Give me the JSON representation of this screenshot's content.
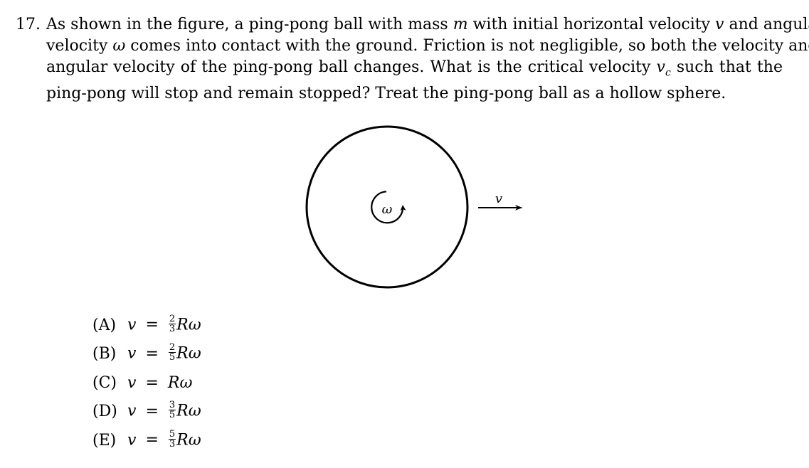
{
  "question": {
    "number": "17.",
    "lines": [
      "As shown in the figure, a ping-pong ball with mass m with initial horizontal velocity v and angular",
      "velocity ω comes into contact with the ground. Friction is not negligible, so both the velocity and",
      "angular velocity of the ping-pong ball changes. What is the critical velocity v_c such that the",
      "ping-pong will stop and remain stopped? Treat the ping-pong ball as a hollow sphere."
    ],
    "segments": {
      "l1a": "As shown in the figure, a ping-pong ball with mass ",
      "m": "m",
      "l1b": " with initial horizontal velocity ",
      "v1": "v",
      "l1c": " and angular",
      "l2a": "velocity ",
      "w": "ω",
      "l2b": " comes into contact with the ground. Friction is not negligible, so both the velocity and",
      "l3a": "angular velocity of the ping-pong ball changes.  What is the critical velocity ",
      "vc": "v",
      "vc_sub": "c",
      "l3b": " such that the",
      "l4": "ping-pong will stop and remain stopped? Treat the ping-pong ball as a hollow sphere."
    }
  },
  "figure": {
    "omega_label": "ω",
    "velocity_label": "v"
  },
  "choices": [
    {
      "label": "(A)",
      "lhs": "v",
      "eq": "=",
      "num": "2",
      "den": "3",
      "rhs": "Rω"
    },
    {
      "label": "(B)",
      "lhs": "v",
      "eq": "=",
      "num": "2",
      "den": "5",
      "rhs": "Rω"
    },
    {
      "label": "(C)",
      "lhs": "v",
      "eq": "=",
      "num": "",
      "den": "",
      "rhs": "Rω"
    },
    {
      "label": "(D)",
      "lhs": "v",
      "eq": "=",
      "num": "3",
      "den": "5",
      "rhs": "Rω"
    },
    {
      "label": "(E)",
      "lhs": "v",
      "eq": "=",
      "num": "5",
      "den": "3",
      "rhs": "Rω"
    }
  ]
}
